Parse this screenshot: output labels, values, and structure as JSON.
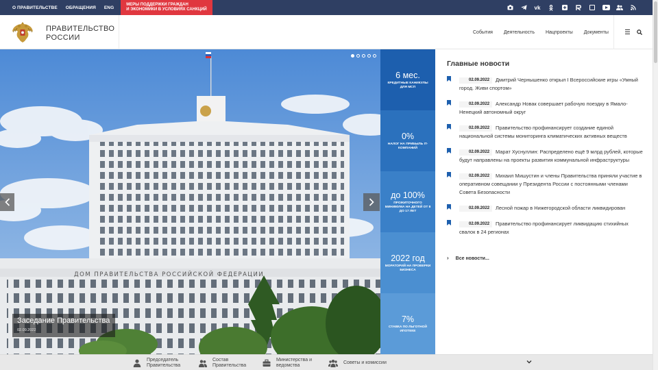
{
  "topbar": {
    "links": [
      "О ПРАВИТЕЛЬСТВЕ",
      "ОБРАЩЕНИЯ",
      "ENG"
    ],
    "promo_line1": "МЕРЫ ПОДДЕРЖКИ ГРАЖДАН",
    "promo_line2": "И ЭКОНОМИКИ В УСЛОВИЯХ САНКЦИЙ",
    "social_icons": [
      "camera-icon",
      "telegram-icon",
      "vk-icon",
      "odnoklassniki-icon",
      "plus-icon",
      "rutube-icon",
      "yandex-zen-icon",
      "youtube-icon",
      "people-icon",
      "rss-icon"
    ]
  },
  "header": {
    "logo_line1": "ПРАВИТЕЛЬСТВО",
    "logo_line2": "РОССИИ",
    "nav": [
      "События",
      "Деятельность",
      "Нацпроекты",
      "Документы"
    ]
  },
  "hero": {
    "slide_count": 5,
    "active_slide": 0,
    "building_sign": "ДОМ ПРАВИТЕЛЬСТВА РОССИЙСКОЙ ФЕДЕРАЦИИ",
    "caption_title": "Заседание Правительства",
    "caption_date": "02.09.2022"
  },
  "stats": [
    {
      "big": "6 мес.",
      "small": "КРЕДИТНЫЕ КАНИКУЛЫ ДЛЯ МСП",
      "color": "#1d5fae"
    },
    {
      "big": "0%",
      "small": "НАЛОГ НА ПРИБЫЛЬ IT-КОМПАНИЙ",
      "color": "#2b71bd"
    },
    {
      "big": "до 100%",
      "small": "ПРОЖИТОЧНОГО МИНИМУМА НА ДЕТЕЙ ОТ 8 ДО 17 ЛЕТ",
      "color": "#3a80c8"
    },
    {
      "big": "2022 год",
      "small": "МОРАТОРИЙ НА ПРОВЕРКИ БИЗНЕСА",
      "color": "#4b8fd1"
    },
    {
      "big": "7%",
      "small": "СТАВКА ПО ЛЬГОТНОЙ ИПОТЕКЕ",
      "color": "#5b9bd8"
    }
  ],
  "news": {
    "title": "Главные новости",
    "items": [
      {
        "date": "02.09.2022",
        "text": "Дмитрий Чернышенко открыл I Всероссийские игры «Умный город. Живи спортом»"
      },
      {
        "date": "02.09.2022",
        "text": "Александр Новак совершает рабочую поездку в Ямало-Ненецкий автономный округ"
      },
      {
        "date": "02.09.2022",
        "text": "Правительство профинансирует создание единой национальной системы мониторинга климатических активных веществ"
      },
      {
        "date": "02.09.2022",
        "text": "Марат Хуснуллин: Распределено ещё 9 млрд рублей, которые будут направлены на проекты развития коммунальной инфраструктуры"
      },
      {
        "date": "02.09.2022",
        "text": "Михаил Мишустин и члены Правительства приняли участие в оперативном совещании у Президента России с постоянными членами Совета Безопасности"
      },
      {
        "date": "02.09.2022",
        "text": "Лесной пожар в Нижегородской области ликвидирован"
      },
      {
        "date": "02.09.2022",
        "text": "Правительство профинансирует ликвидацию стихийных свалок в 24 регионах"
      }
    ],
    "all_label": "Все новости..."
  },
  "bottombar": {
    "items": [
      {
        "line1": "Председатель",
        "line2": "Правительства",
        "icon": "person-icon"
      },
      {
        "line1": "Состав",
        "line2": "Правительства",
        "icon": "group-icon"
      },
      {
        "line1": "Министерства и",
        "line2": "ведомства",
        "icon": "briefcase-icon"
      },
      {
        "line1": "Советы и комиссии",
        "line2": "",
        "icon": "people-icon"
      }
    ]
  },
  "colors": {
    "topbar": "#2f3f63",
    "promo": "#e0373f",
    "accent_blue": "#1d5fae"
  }
}
